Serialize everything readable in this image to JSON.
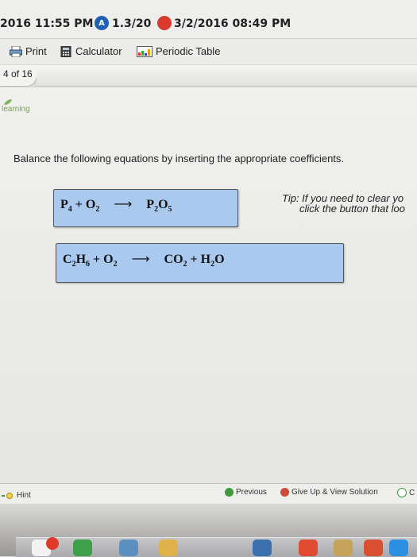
{
  "statusbar": {
    "datetime_left": "2016 11:55 PM",
    "version": "1.3/20",
    "datetime_right": "3/2/2016 08:49 PM"
  },
  "toolbar": {
    "print_label": "Print",
    "calculator_label": "Calculator",
    "periodic_table_label": "Periodic Table"
  },
  "page_indicator": "4 of 16",
  "logo_text": "learning",
  "instruction": "Balance the following equations by inserting the appropriate coefficients.",
  "equations": [
    {
      "reactants": [
        {
          "sym": "P",
          "sub": "4"
        },
        {
          "sym": "O",
          "sub": "2"
        }
      ],
      "products": [
        {
          "sym": "P",
          "sub": "2",
          "sym2": "O",
          "sub2": "5"
        }
      ]
    },
    {
      "reactants": [
        {
          "sym": "C",
          "sub": "2",
          "sym2": "H",
          "sub2": "6"
        },
        {
          "sym": "O",
          "sub": "2"
        }
      ],
      "products": [
        {
          "sym": "CO",
          "sub": "2"
        },
        {
          "sym": "H",
          "sub": "2",
          "sym2": "O"
        }
      ]
    }
  ],
  "tip": {
    "line1": "Tip: If you need to clear yo",
    "line2": "click the button that loo"
  },
  "bottombar": {
    "hint_label": "Hint",
    "previous_label": "Previous",
    "giveup_label": "Give Up & View Solution",
    "check_label": "C"
  },
  "colors": {
    "equation_box": "#a9c9ee",
    "accent_green": "#3d9a3d",
    "giveup_red": "#d04a3a"
  }
}
